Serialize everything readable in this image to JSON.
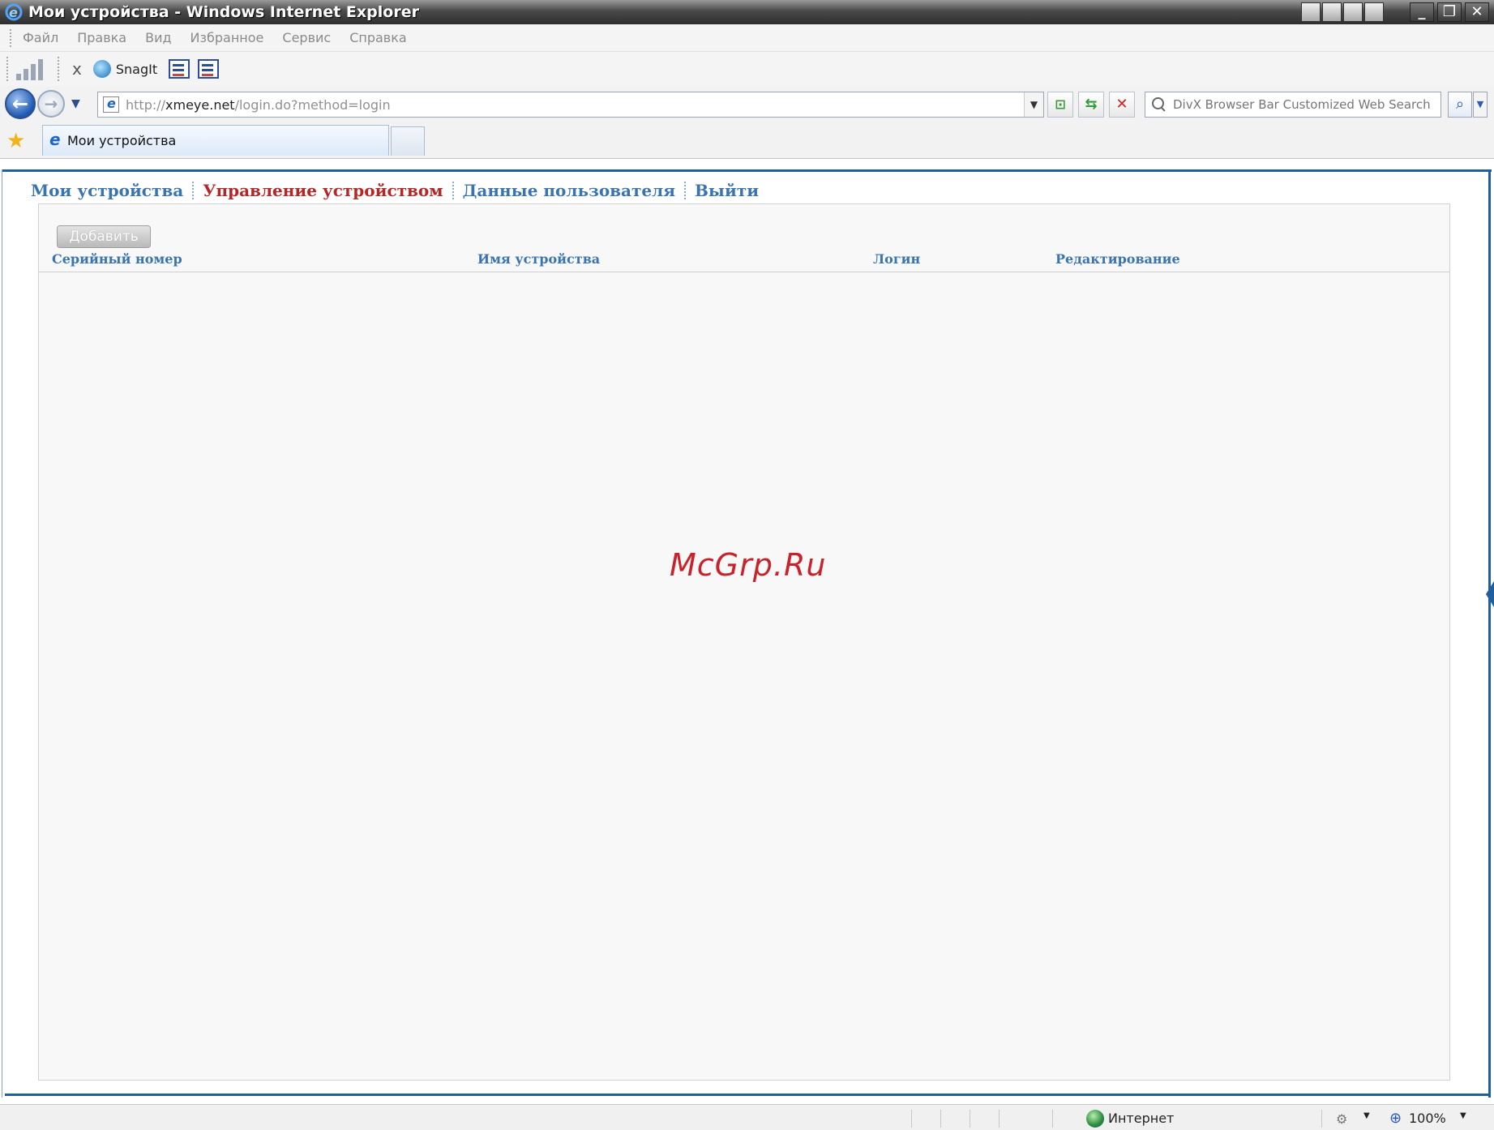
{
  "window": {
    "title": "Мои устройства - Windows Internet Explorer",
    "controls": {
      "minimize": "_",
      "maximize": "❐",
      "close": "✕"
    }
  },
  "menu": [
    "Файл",
    "Правка",
    "Вид",
    "Избранное",
    "Сервис",
    "Справка"
  ],
  "toolbar": {
    "close_glyph": "x",
    "snagit_label": "SnagIt"
  },
  "address": {
    "scheme": "http://",
    "host": "xmeye.net",
    "path": "/login.do?method=login"
  },
  "search": {
    "placeholder": "DivX Browser Bar Customized Web Search"
  },
  "tabs": [
    {
      "label": "Мои устройства"
    }
  ],
  "page": {
    "nav": [
      {
        "label": "Мои устройства",
        "active": false
      },
      {
        "label": "Управление устройством",
        "active": true
      },
      {
        "label": "Данные пользователя",
        "active": false
      },
      {
        "label": "Выйти",
        "active": false
      }
    ],
    "add_button": "Добавить",
    "columns": [
      "Серийный номер",
      "Имя устройства",
      "Логин",
      "Редактирование"
    ],
    "rows": [],
    "watermark": "McGrp.Ru"
  },
  "status": {
    "zone": "Интернет",
    "zoom": "100%"
  },
  "colors": {
    "nav_link": "#3a74b0",
    "nav_active": "#b52626",
    "frame_blue": "#1f5f9e",
    "watermark": "#c8232b"
  },
  "icons": [
    "ie-logo-icon",
    "signal-bars-icon",
    "snagit-icon",
    "back-arrow-icon",
    "forward-arrow-icon",
    "compat-view-icon",
    "refresh-icon",
    "stop-icon",
    "search-icon",
    "favorites-star-icon",
    "globe-icon",
    "zoom-icon"
  ]
}
